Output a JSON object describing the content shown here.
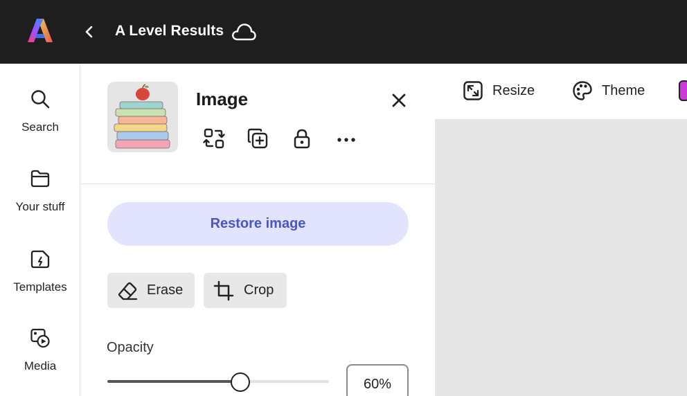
{
  "header": {
    "document_title": "A Level Results",
    "icons": {
      "logo": "adobe-express-logo",
      "back": "chevron-left-icon",
      "cloud": "cloud-icon"
    }
  },
  "sidebar": {
    "items": [
      {
        "id": "search",
        "label": "Search",
        "icon": "search-icon"
      },
      {
        "id": "your-stuff",
        "label": "Your stuff",
        "icon": "folder-icon"
      },
      {
        "id": "templates",
        "label": "Templates",
        "icon": "templates-icon"
      },
      {
        "id": "media",
        "label": "Media",
        "icon": "media-icon"
      }
    ]
  },
  "panel": {
    "title": "Image",
    "tools": [
      {
        "id": "replace",
        "icon": "replace-icon"
      },
      {
        "id": "duplicate",
        "icon": "duplicate-icon"
      },
      {
        "id": "lock",
        "icon": "lock-icon"
      },
      {
        "id": "more",
        "icon": "more-icon"
      }
    ],
    "restore_label": "Restore image",
    "erase_label": "Erase",
    "crop_label": "Crop",
    "opacity_label": "Opacity",
    "opacity_value": "60%",
    "opacity_fraction": 0.6
  },
  "toolbar": {
    "resize_label": "Resize",
    "theme_label": "Theme"
  },
  "colors": {
    "topbar": "#1e1e1e",
    "accent_text": "#4a55c8",
    "restore_bg": "#e1e4fc",
    "canvas": "#e6e6e6"
  }
}
